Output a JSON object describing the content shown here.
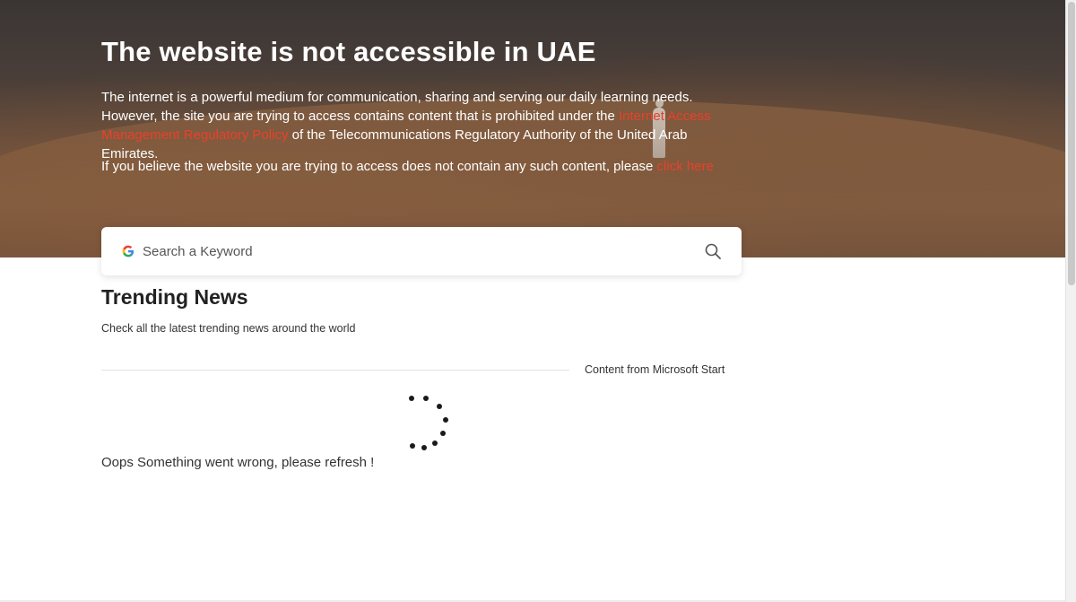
{
  "hero": {
    "title": "The website is not accessible in UAE",
    "paragraph_start": "The internet is a powerful medium for communication, sharing and serving our daily learning needs. However, the site you are trying to access contains content that is prohibited under the ",
    "policy_link": "Internet Access Management Regulatory Policy",
    "paragraph_end": " of the Telecommunications Regulatory Authority of the United Arab Emirates.",
    "believe_text": "If you believe the website you are trying to access does not contain any such content, please ",
    "click_here": "click here"
  },
  "search": {
    "placeholder": "Search a Keyword",
    "icon": "google-icon",
    "submit_icon": "search-icon"
  },
  "trending": {
    "title": "Trending News",
    "subtitle": "Check all the latest trending news around the world",
    "source": "Content from Microsoft Start",
    "error": "Oops Something went wrong, please refresh !"
  },
  "colors": {
    "link": "#e8412c",
    "text_dark": "#222222",
    "hero_text": "#ffffff"
  }
}
